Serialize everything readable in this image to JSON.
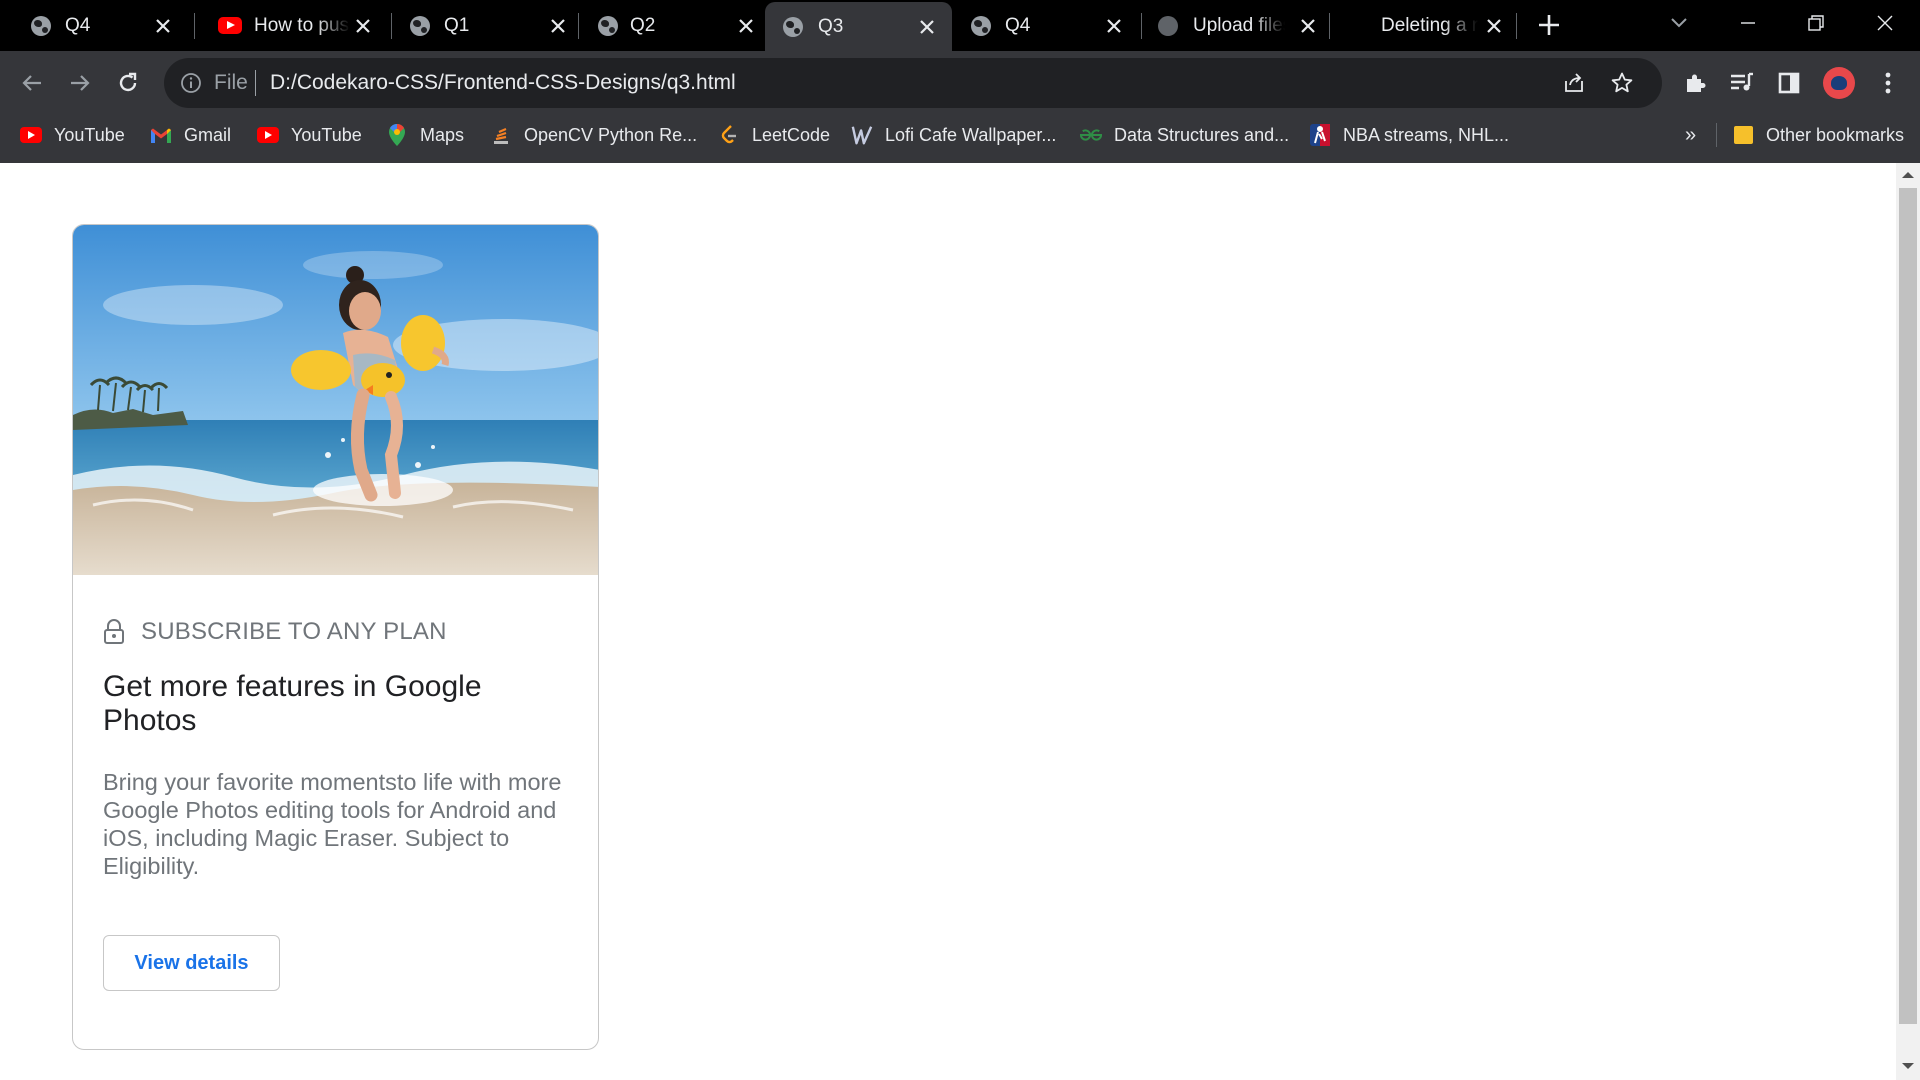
{
  "browser": {
    "tabs": [
      {
        "title": "Q4",
        "icon": "globe-icon",
        "active": false
      },
      {
        "title": "How to push",
        "icon": "youtube-icon",
        "active": false
      },
      {
        "title": "Q1",
        "icon": "globe-icon",
        "active": false
      },
      {
        "title": "Q2",
        "icon": "globe-icon",
        "active": false
      },
      {
        "title": "Q3",
        "icon": "globe-icon",
        "active": true
      },
      {
        "title": "Q4",
        "icon": "globe-icon",
        "active": false
      },
      {
        "title": "Upload files",
        "icon": "github-icon",
        "active": false
      },
      {
        "title": "Deleting a r",
        "icon": "none",
        "active": false
      }
    ],
    "address": {
      "scheme_label": "File",
      "url": "D:/Codekaro-CSS/Frontend-CSS-Designs/q3.html"
    },
    "bookmarks": [
      {
        "label": "YouTube",
        "icon": "youtube-icon"
      },
      {
        "label": "Gmail",
        "icon": "gmail-icon"
      },
      {
        "label": "YouTube",
        "icon": "youtube-icon"
      },
      {
        "label": "Maps",
        "icon": "maps-icon"
      },
      {
        "label": "OpenCV Python Re...",
        "icon": "opencv-icon"
      },
      {
        "label": "LeetCode",
        "icon": "leetcode-icon"
      },
      {
        "label": "Lofi Cafe Wallpaper...",
        "icon": "wallpaper-icon"
      },
      {
        "label": "Data Structures and...",
        "icon": "gfg-icon"
      },
      {
        "label": "NBA streams, NHL...",
        "icon": "nba-icon"
      }
    ],
    "overflow_label": "»",
    "other_bookmarks_label": "Other bookmarks"
  },
  "card": {
    "eyebrow": "SUBSCRIBE TO ANY PLAN",
    "title": "Get more features in Google Photos",
    "body": "Bring your favorite momentsto life with more Google Photos editing tools for Android and iOS, including Magic Eraser. Subject to Eligibility.",
    "button_label": "View details"
  },
  "colors": {
    "accent": "#1a73e8",
    "tabstrip": "#000000",
    "toolbar": "#35363a",
    "omnibox": "#202124",
    "muted_text": "#70757a"
  }
}
